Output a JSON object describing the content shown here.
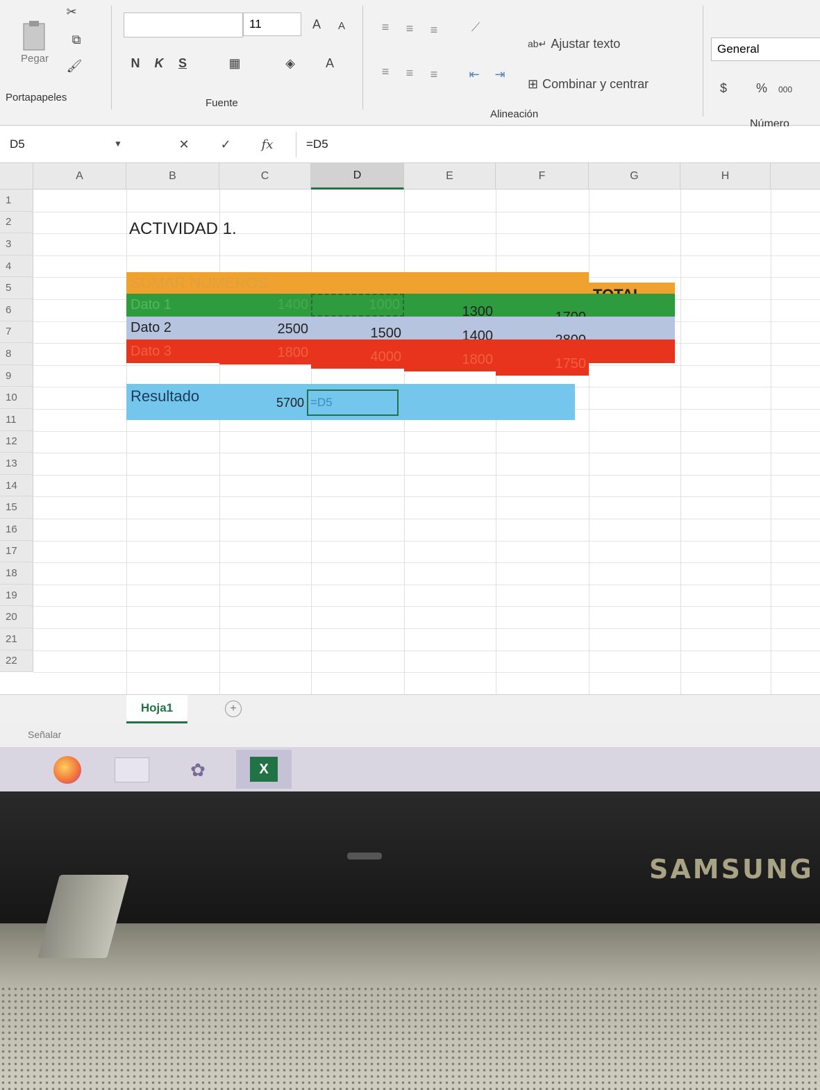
{
  "ribbon": {
    "clipboard": {
      "paste_label": "Pegar",
      "group_label": "Portapapeles"
    },
    "font": {
      "size_value": "11",
      "bold": "N",
      "italic": "K",
      "underline": "S",
      "group_label": "Fuente"
    },
    "alignment": {
      "wrap_text_label": "Ajustar texto",
      "merge_center_label": "Combinar y centrar",
      "group_label": "Alineación"
    },
    "number": {
      "format_value": "General",
      "currency_symbol": "$",
      "percent_symbol": "%",
      "thousands_label": "000",
      "group_label": "Número"
    }
  },
  "formula_bar": {
    "name_box": "D5",
    "cancel_symbol": "✕",
    "enter_symbol": "✓",
    "fx_label": "fx",
    "formula": "=D5"
  },
  "columns": [
    "A",
    "B",
    "C",
    "D",
    "E",
    "F",
    "G",
    "H"
  ],
  "rows": [
    "1",
    "2",
    "3",
    "4",
    "5",
    "6",
    "7",
    "8",
    "9",
    "10",
    "11",
    "12",
    "13",
    "14",
    "15",
    "16",
    "17",
    "18",
    "19",
    "20",
    "21",
    "22"
  ],
  "sheet": {
    "title": "ACTIVIDAD 1.",
    "header": "SUMAR NUMEROS",
    "total_label": "TOTAL",
    "data_rows": [
      {
        "label": "Dato 1",
        "values": [
          "1400",
          "1000",
          "1300",
          "1700"
        ]
      },
      {
        "label": "Dato 2",
        "values": [
          "2500",
          "1500",
          "1400",
          "2800"
        ]
      },
      {
        "label": "Dato 3",
        "values": [
          "1800",
          "4000",
          "1800",
          "1750"
        ]
      }
    ],
    "result_label": "Resultado",
    "result_value": "5700",
    "editing_formula": "=D5"
  },
  "tabs": {
    "sheet1": "Hoja1",
    "add_symbol": "+"
  },
  "status_bar": {
    "mode": "Señalar"
  },
  "laptop": {
    "brand": "SAMSUNG"
  },
  "colors": {
    "orange": "#f0a22e",
    "green": "#2e9b3e",
    "light_blue_gray": "#b7c4e0",
    "red": "#e8341c",
    "result_blue": "#74c6ec",
    "excel_green": "#217346"
  }
}
